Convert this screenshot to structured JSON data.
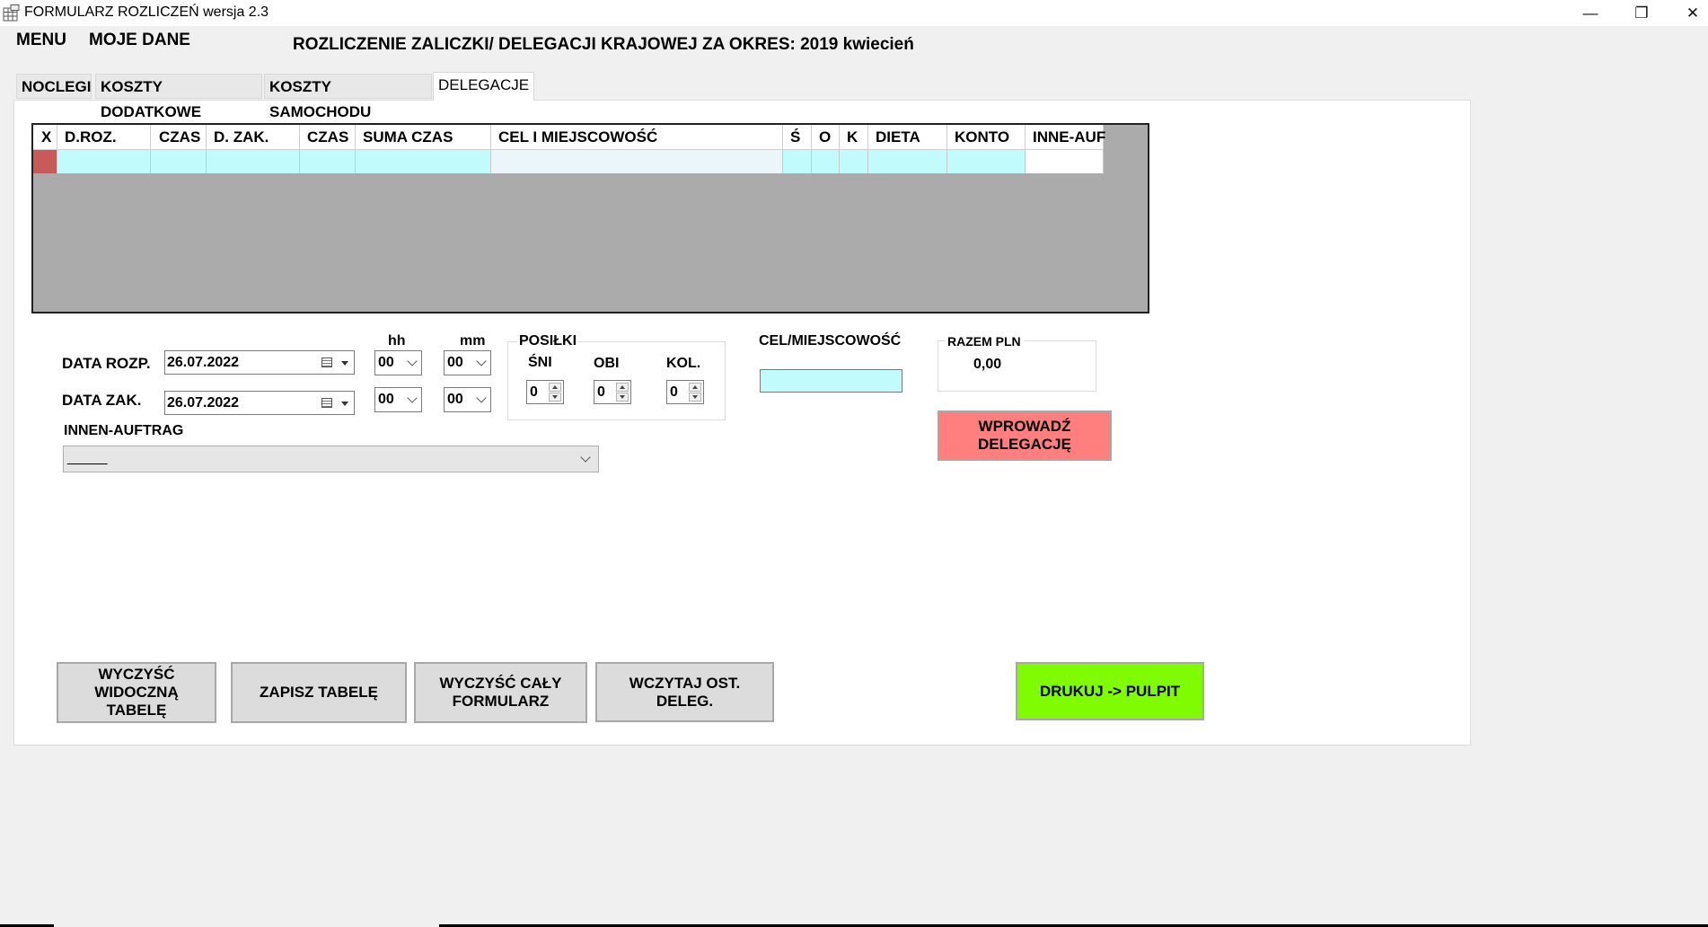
{
  "window": {
    "title": "FORMULARZ ROZLICZEŃ wersja 2.3",
    "minimize": "—",
    "restore": "❐",
    "close": "✕"
  },
  "menu": {
    "items": [
      "MENU",
      "MOJE DANE"
    ]
  },
  "header": {
    "period_label": "ROZLICZENIE ZALICZKI/ DELEGACJI KRAJOWEJ ZA OKRES:  2019 kwiecień"
  },
  "tabs": [
    "NOCLEGI",
    "KOSZTY DODATKOWE",
    "KOSZTY SAMOCHODU",
    "DELEGACJE"
  ],
  "active_tab": "DELEGACJE",
  "grid": {
    "columns": [
      "X",
      "D.ROZ.",
      "CZAS",
      "D. ZAK.",
      "CZAS",
      "SUMA CZAS",
      "CEL I MIEJSCOWOŚĆ",
      "Ś",
      "O",
      "K",
      "DIETA",
      "KONTO",
      "INNE-AUF"
    ],
    "rows": [
      [
        "",
        "",
        "",
        "",
        "",
        "",
        "",
        "",
        "",
        "",
        "",
        "",
        ""
      ]
    ]
  },
  "form": {
    "hh_label": "hh",
    "mm_label": "mm",
    "date_start_label": "DATA ROZP.",
    "date_start_value": "26.07.2022",
    "date_start_hh": "00",
    "date_start_mm": "00",
    "date_end_label": "DATA ZAK.",
    "date_end_value": "26.07.2022",
    "date_end_hh": "00",
    "date_end_mm": "00",
    "innen_label": "INNEN-AUFTRAG",
    "innen_value": "_____",
    "meals": {
      "label": "POSIŁKI",
      "breakfast_label": "ŚNI",
      "breakfast_value": "0",
      "lunch_label": "OBI",
      "lunch_value": "0",
      "dinner_label": "KOL.",
      "dinner_value": "0"
    },
    "destination_label": "CEL/MIEJSCOWOŚĆ",
    "destination_value": "",
    "total_label": "RAZEM PLN",
    "total_value": "0,00",
    "enter_button": "WPROWADŹ DELEGACJĘ"
  },
  "buttons": {
    "clear_visible": "WYCZYŚĆ WIDOCZNĄ TABELĘ",
    "save_table": "ZAPISZ TABELĘ",
    "clear_form": "WYCZYŚĆ CAŁY FORMULARZ",
    "load_last": "WCZYTAJ OST. DELEG.",
    "print": "DRUKUJ -> PULPIT"
  },
  "colors": {
    "cyan_cell": "#c2fbfb",
    "light_cell": "#ebf6fb",
    "row_marker": "#c85a5a",
    "enter_button": "#ff7f7f",
    "print_button": "#7ffc00",
    "grid_background": "#ababab"
  }
}
